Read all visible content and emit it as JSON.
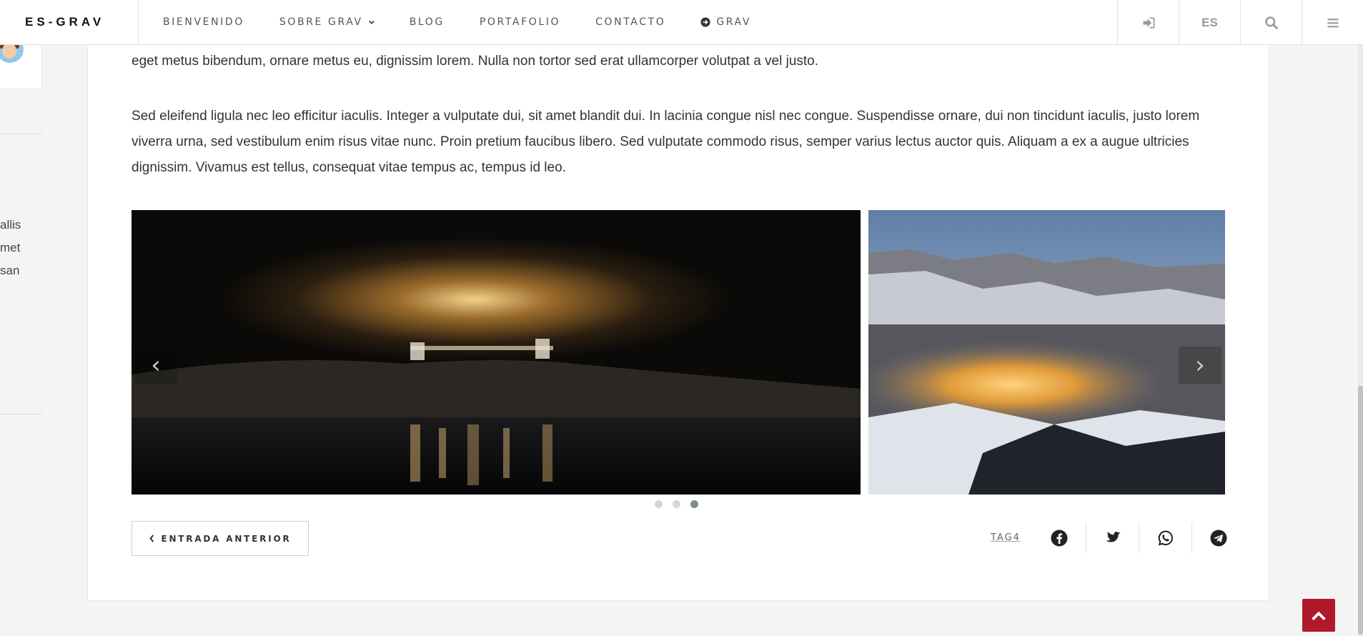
{
  "header": {
    "brand": "ES-GRAV",
    "menu": [
      {
        "label": "BIENVENIDO"
      },
      {
        "label": "SOBRE GRAV"
      },
      {
        "label": "BLOG"
      },
      {
        "label": "PORTAFOLIO"
      },
      {
        "label": "CONTACTO"
      },
      {
        "label": "GRAV"
      }
    ],
    "language": "ES",
    "icons": [
      "sign-in-icon",
      "search-icon",
      "hamburger-icon"
    ]
  },
  "sidebar": {
    "text_fragments": [
      "allis",
      "met",
      "san"
    ]
  },
  "article": {
    "paragraph_1": "eget metus bibendum, ornare metus eu, dignissim lorem. Nulla non tortor sed erat ullamcorper volutpat a vel justo.",
    "paragraph_2_line_1": "Sed eleifend ligula nec leo efficitur iaculis. Integer a vulputate dui, sit amet blandit dui. In lacinia congue nisl nec congue. Suspendisse ornare, dui non tincidunt iaculis, justo lorem",
    "paragraph_2_line_2": "viverra urna, sed vestibulum enim risus vitae nunc. Proin pretium faucibus libero. Sed vulputate commodo risus, semper varius lectus auctor quis. Aliquam a ex a augue ultricies",
    "paragraph_2_line_3": "dignissim. Vivamus est tellus, consequat vitae tempus ac, tempus id leo."
  },
  "carousel": {
    "prev_symbol": "‹",
    "next_symbol": "›",
    "slides": [
      "night-lake-photo",
      "snowy-mountains-photo"
    ],
    "dots_count": 3,
    "active_dot": 3
  },
  "footer_row": {
    "prev_post_label": "ENTRADA ANTERIOR",
    "tag_label": "TAG4",
    "share_icons": [
      "facebook-icon",
      "twitter-icon",
      "whatsapp-icon",
      "telegram-icon"
    ]
  },
  "colors": {
    "accent": "#b0182b",
    "dot_active": "#7f8c8d",
    "dot_inactive": "#d6d6d6"
  }
}
